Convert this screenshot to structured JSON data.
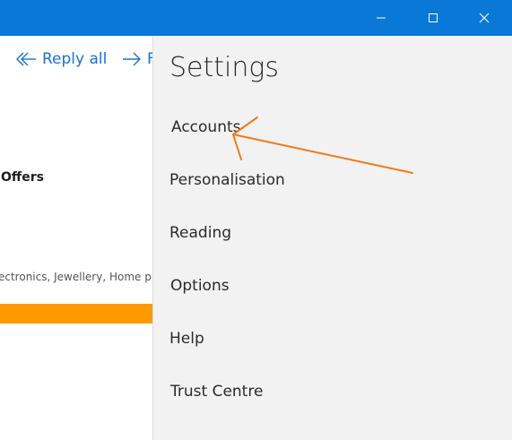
{
  "window": {
    "accent_color": "#0a78d6"
  },
  "mail": {
    "toolbar": {
      "reply_all_label": "Reply all",
      "forward_label": "F"
    },
    "offers_heading": "Offers",
    "categories_text": "ectronics, Jewellery, Home pr",
    "banner_color": "#ff9900"
  },
  "settings": {
    "title": "Settings",
    "items": [
      {
        "label": "Accounts"
      },
      {
        "label": "Personalisation"
      },
      {
        "label": "Reading"
      },
      {
        "label": "Options"
      },
      {
        "label": "Help"
      },
      {
        "label": "Trust Centre"
      }
    ]
  },
  "annotation": {
    "color": "#f07a1a",
    "icon": "arrow-annotation"
  }
}
